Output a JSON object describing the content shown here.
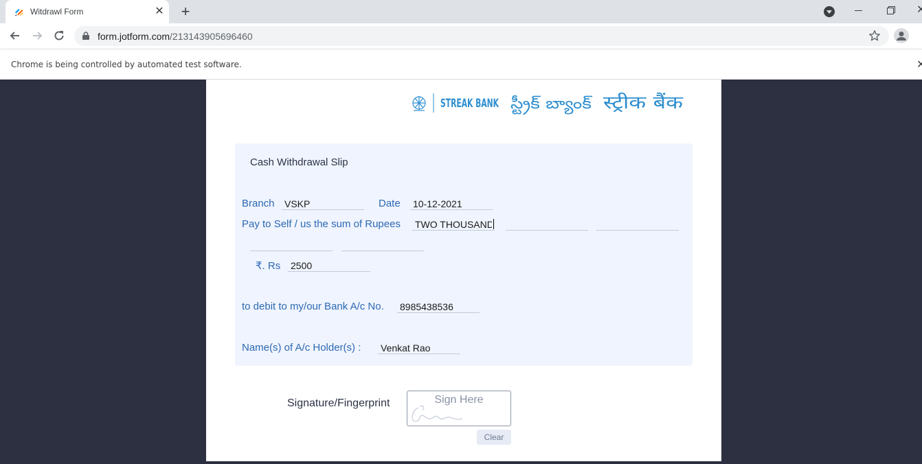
{
  "browser": {
    "tab_title": "Witdrawl Form",
    "tab_close": "✕",
    "new_tab": "+",
    "url_host": "form.jotform.com",
    "url_path": "/213143905696460",
    "infobar_text": "Chrome is being controlled by automated test software.",
    "infobar_close": "✕",
    "window_close": "✕"
  },
  "logo": {
    "english": "STREAK BANK",
    "telugu": "స్ట్రీక్ బ్యాంక్",
    "hindi": "स्ट्रीक बैंक",
    "color": "#2f8fd0"
  },
  "form": {
    "title": "Cash Withdrawal Slip",
    "branch_label": "Branch",
    "branch_value": "VSKP",
    "date_label": "Date",
    "date_value": "10-12-2021",
    "sum_label": "Pay to Self / us the sum of Rupees",
    "sum_words_1": "TWO THOUSAND",
    "sum_words_2": "",
    "sum_words_3": "",
    "sum_words_4": "",
    "sum_words_5": "",
    "amount_label": "₹. Rs",
    "amount_value": "2500",
    "account_label": "to debit to my/our Bank A/c No.",
    "account_value": "8985438536",
    "holder_label": "Name(s) of A/c Holder(s) :",
    "holder_value": "Venkat Rao",
    "signature_label": "Signature/Fingerprint",
    "signature_placeholder": "Sign Here",
    "clear_label": "Clear"
  },
  "colors": {
    "page_bg": "#2c3040",
    "slip_bg": "#eff4fe",
    "label_blue": "#2e69b3"
  }
}
